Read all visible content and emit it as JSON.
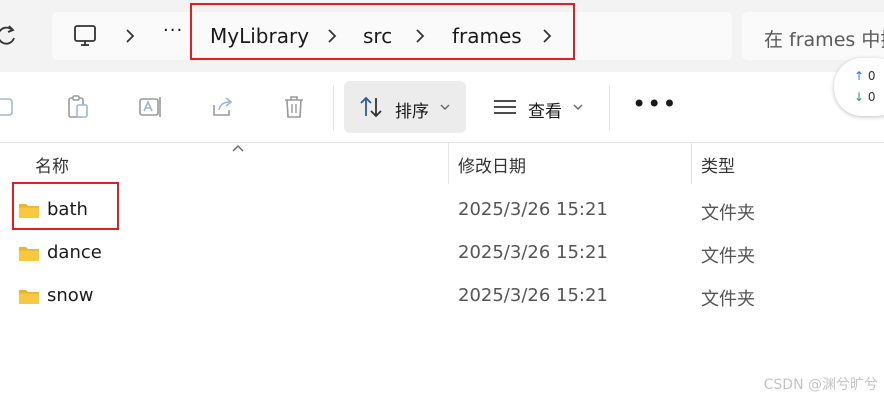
{
  "address_bar": {
    "crumbs": [
      "MyLibrary",
      "src",
      "frames"
    ],
    "overflow_glyph": "···",
    "search_placeholder": "在 frames 中搜"
  },
  "toolbar": {
    "sort_label": "排序",
    "view_label": "查看",
    "more_glyph": "•••"
  },
  "sync_status": {
    "up_count": "0",
    "down_count": "0"
  },
  "columns": {
    "name": "名称",
    "modified": "修改日期",
    "type": "类型"
  },
  "files": [
    {
      "name": "bath",
      "modified": "2025/3/26 15:21",
      "type": "文件夹"
    },
    {
      "name": "dance",
      "modified": "2025/3/26 15:21",
      "type": "文件夹"
    },
    {
      "name": "snow",
      "modified": "2025/3/26 15:21",
      "type": "文件夹"
    }
  ],
  "watermark": "CSDN @渊兮旷兮",
  "colors": {
    "annotation_red": "#e02020",
    "folder_yellow": "#f8c840",
    "sync_up": "#1a73e8",
    "sync_down": "#1aa260"
  }
}
